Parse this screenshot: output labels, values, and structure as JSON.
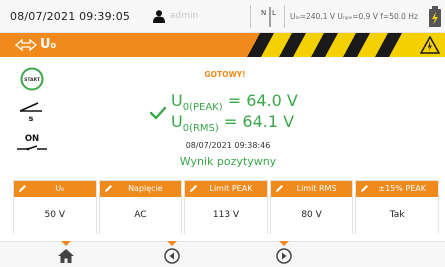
{
  "statusbar": {
    "datetime": "08/07/2021 09:39:05",
    "user": "admin",
    "measurements": "Uₗₙ=240.1 V Uₙₚₑ=0.9 V f=50.0 Hz"
  },
  "title": {
    "label": "U₀"
  },
  "result": {
    "status": "GOTOWY!",
    "peak_label": "U",
    "peak_sub": "0(PEAK)",
    "peak_value": " = 64.0 V",
    "rms_label": "U",
    "rms_sub": "0(RMS)",
    "rms_value": " = 64.1 V",
    "timestamp": "08/07/2021 09:38:46",
    "verdict": "Wynik pozytywny"
  },
  "side": {
    "start_label": "START",
    "on_label": "ON"
  },
  "params": [
    {
      "label": "U₀",
      "value": "50 V"
    },
    {
      "label": "Napięcie",
      "value": "AC"
    },
    {
      "label": "Limit PEAK",
      "value": "113 V"
    },
    {
      "label": "Limit RMS",
      "value": "80 V"
    },
    {
      "label": "±15% PEAK",
      "value": "Tak"
    }
  ],
  "colors": {
    "accent": "#f08a1c",
    "pass": "#3aa84a",
    "stripe_dark": "#1a1a1a",
    "stripe_light": "#f5d000"
  }
}
